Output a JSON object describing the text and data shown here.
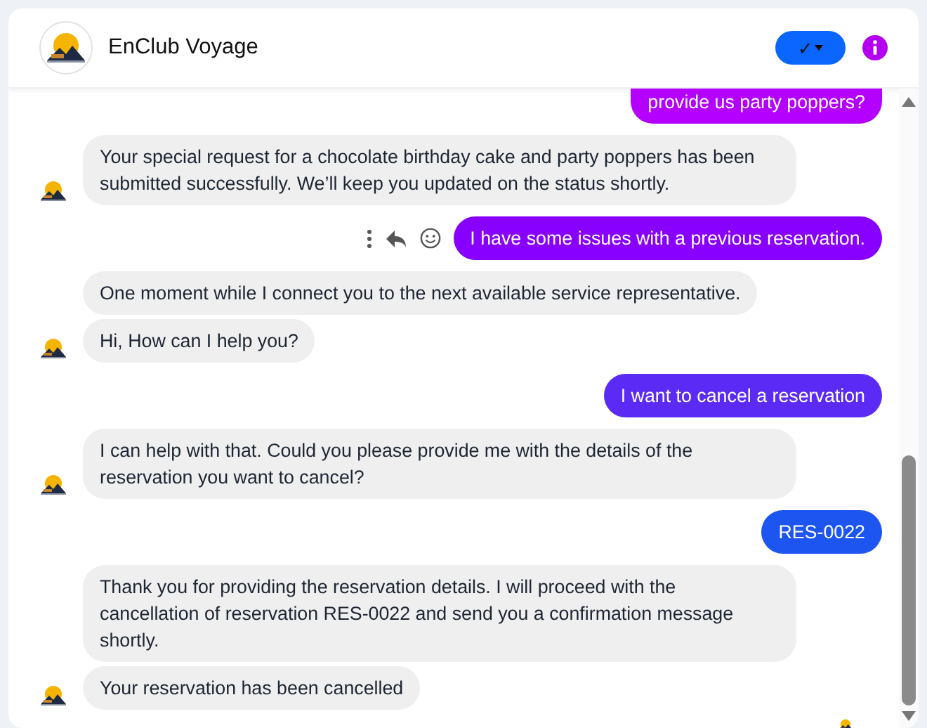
{
  "header": {
    "title": "EnClub Voyage",
    "action_button": "✓"
  },
  "messages": [
    {
      "kind": "user",
      "text": "provide us party poppers?",
      "color": "#b300ff",
      "clipped": true,
      "actions": false
    },
    {
      "kind": "bot",
      "text": "Your special request for a chocolate birthday cake and party poppers has been submitted successfully. We’ll keep you updated on the status shortly.",
      "show_avatar": true
    },
    {
      "kind": "user",
      "text": "I have some issues with a previous reservation.",
      "color": "#8800ff",
      "clipped": false,
      "actions": true
    },
    {
      "kind": "bot",
      "text": "One moment while I connect you to the next available service representative.",
      "show_avatar": false
    },
    {
      "kind": "bot",
      "text": "Hi, How can I help you?",
      "show_avatar": true
    },
    {
      "kind": "user",
      "text": "I want to cancel a reservation",
      "color": "#5b2bf5",
      "clipped": false,
      "actions": false
    },
    {
      "kind": "bot",
      "text": "I can help with that. Could you please provide me with the details of the reservation you want to cancel?",
      "show_avatar": true
    },
    {
      "kind": "user",
      "text": "RES-0022",
      "color": "#1d55f0",
      "clipped": false,
      "actions": false
    },
    {
      "kind": "bot",
      "text": "Thank you for providing the reservation details. I will proceed with the cancellation of reservation RES-0022 and send you a confirmation message shortly.",
      "show_avatar": false
    },
    {
      "kind": "bot",
      "text": "Your reservation has been cancelled",
      "show_avatar": true
    }
  ],
  "read_receipt": true
}
